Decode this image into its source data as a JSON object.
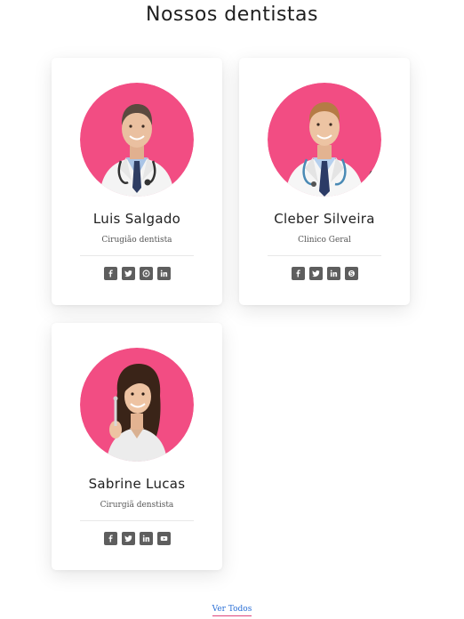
{
  "page": {
    "title": "Nossos dentistas",
    "see_all_label": "Ver Todos"
  },
  "colors": {
    "avatar_background": "#f24d83",
    "social_button": "#5e5e5e",
    "link": "#2a6fd6",
    "link_underline": "#e0457b"
  },
  "team": [
    {
      "name": "Luis Salgado",
      "role": "Cirugião dentista",
      "social": [
        "facebook-icon",
        "twitter-icon",
        "whatsapp-icon",
        "linkedin-icon"
      ]
    },
    {
      "name": "Cleber Silveira",
      "role": "Clinico Geral",
      "social": [
        "facebook-icon",
        "twitter-icon",
        "linkedin-icon",
        "skype-icon"
      ]
    },
    {
      "name": "Sabrine Lucas",
      "role": "Cirurgiã denstista",
      "social": [
        "facebook-icon",
        "twitter-icon",
        "linkedin-icon",
        "youtube-icon"
      ]
    }
  ]
}
